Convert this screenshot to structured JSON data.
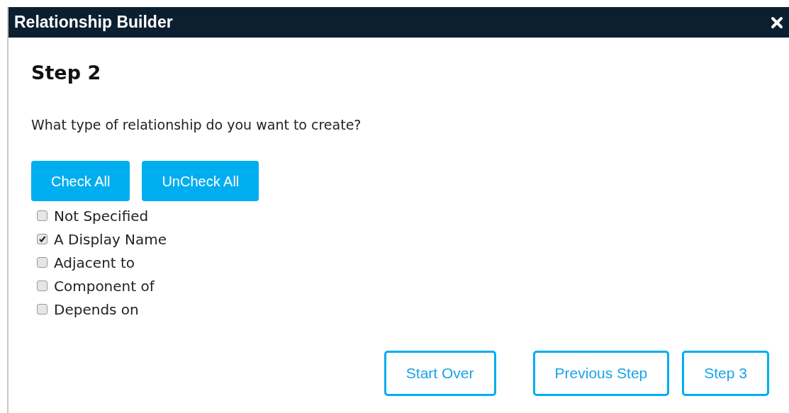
{
  "window": {
    "title": "Relationship Builder"
  },
  "heading": "Step 2",
  "question": "What type of relationship do you want to create?",
  "bulk_buttons": [
    "Check All",
    "UnCheck All"
  ],
  "options": [
    {
      "label": "Not Specified",
      "checked": false
    },
    {
      "label": "A Display Name",
      "checked": true
    },
    {
      "label": "Adjacent to",
      "checked": false
    },
    {
      "label": "Component of",
      "checked": false
    },
    {
      "label": "Depends on",
      "checked": false
    }
  ],
  "footer_buttons": [
    "Start Over",
    "Previous Step",
    "Step 3"
  ]
}
